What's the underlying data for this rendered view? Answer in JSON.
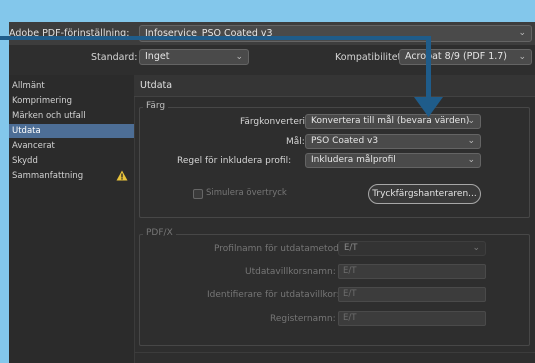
{
  "header": {
    "preset_label": "Adobe PDF-förinställning:",
    "preset_value": "Infoservice_PSO Coated v3",
    "standard_label": "Standard:",
    "standard_value": "Inget",
    "compat_label": "Kompatibilitet:",
    "compat_value": "Acrobat 8/9 (PDF 1.7)"
  },
  "sidebar": {
    "items": [
      {
        "label": "Allmänt"
      },
      {
        "label": "Komprimering"
      },
      {
        "label": "Märken och utfall"
      },
      {
        "label": "Utdata"
      },
      {
        "label": "Avancerat"
      },
      {
        "label": "Skydd"
      },
      {
        "label": "Sammanfattning"
      }
    ],
    "active": "Utdata"
  },
  "main": {
    "section_title": "Utdata",
    "color": {
      "legend": "Färg",
      "conversion_label": "Färgkonvertering:",
      "conversion_value": "Konvertera till mål (bevara värden)",
      "target_label": "Mål:",
      "target_value": "PSO Coated v3",
      "profile_rule_label": "Regel för inkludera profil:",
      "profile_rule_value": "Inkludera målprofil",
      "simulate_label": "Simulera övertryck",
      "ink_manager_label": "Tryckfärgshanteraren..."
    },
    "pdfx": {
      "legend": "PDF/X",
      "profile_name_label": "Profilnamn för utdatametod:",
      "profile_name_value": "E/T",
      "condition_name_label": "Utdatavillkorsnamn:",
      "condition_name_value": "E/T",
      "condition_id_label": "Identifierare för utdatavillkor:",
      "condition_id_value": "E/T",
      "registry_label": "Registernamn:",
      "registry_value": "E/T"
    }
  },
  "colors": {
    "annotation_arrow": "#1f5c8a",
    "frame": "#83c7eb",
    "active_item": "#4d6e96",
    "warning": "#e8c33a"
  }
}
